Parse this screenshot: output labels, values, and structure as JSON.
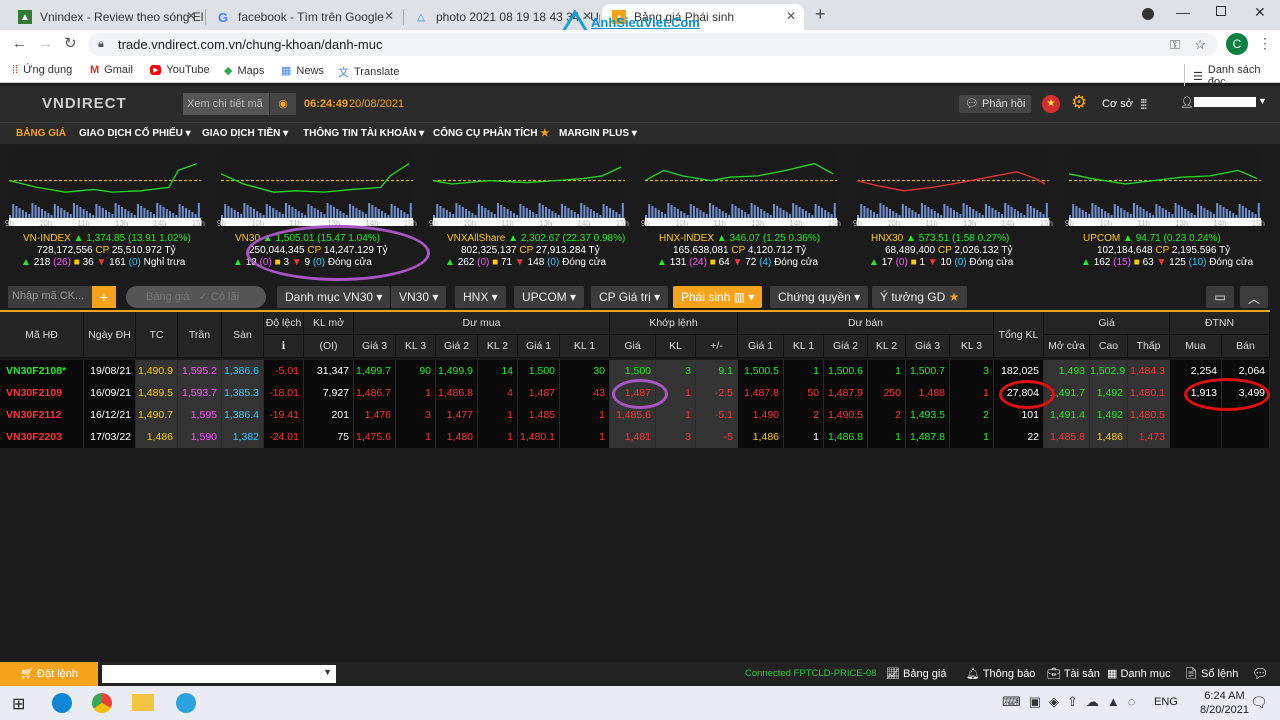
{
  "browser": {
    "tabs": [
      {
        "title": "Vnindex - Review theo sóng Elliott",
        "icon": "chart-favicon"
      },
      {
        "title": "facebook - Tìm trên Google",
        "icon": "google-favicon"
      },
      {
        "title": "photo 2021 08 19 18 43 34 - Up",
        "icon": "upload-favicon"
      },
      {
        "title": "Bảng giá Phái sinh",
        "icon": "vndirect-favicon"
      }
    ],
    "url": "trade.vndirect.com.vn/chung-khoan/danh-muc",
    "profile_letter": "C",
    "bookmarks": [
      "Ứng dụng",
      "Gmail",
      "YouTube",
      "Maps",
      "News",
      "Translate"
    ],
    "reading_list": "Danh sách đọc",
    "watermark": "AnhSieuViet.Com"
  },
  "app": {
    "logo": "VNDIRECT",
    "search_placeholder": "Xem chi tiết mã",
    "clock": "06:24:49",
    "date": "20/08/2021",
    "feedback": "Phản hồi",
    "mode": "Cơ sở",
    "menu": [
      "BẢNG GIÁ",
      "GIAO DỊCH CỔ PHIẾU",
      "GIAO DỊCH TIỀN",
      "THÔNG TIN TÀI KHOẢN",
      "CÔNG CỤ PHÂN TÍCH",
      "MARGIN PLUS"
    ]
  },
  "indices": [
    {
      "name": "VN-INDEX",
      "value": "1,374.85",
      "change": "(13.91 1.02%)",
      "vol": "728,172,556",
      "cp": "CP",
      "val": "25,510.972 Tỷ",
      "up": "218",
      "upc": "(26)",
      "ref": "36",
      "down": "161",
      "downc": "(0)",
      "state": "Nghỉ trưa"
    },
    {
      "name": "VN30",
      "value": "1,505.01",
      "change": "(15.47 1.04%)",
      "vol": "250,044,345",
      "cp": "CP",
      "val": "14,247.129 Tỷ",
      "up": "18",
      "upc": "(0)",
      "ref": "3",
      "down": "9",
      "downc": "(0)",
      "state": "Đóng cửa"
    },
    {
      "name": "VNXAllShare",
      "value": "2,302.67",
      "change": "(22.37 0.98%)",
      "vol": "802,325,137",
      "cp": "CP",
      "val": "27,913.284 Tỷ",
      "up": "262",
      "upc": "(0)",
      "ref": "71",
      "down": "148",
      "downc": "(0)",
      "state": "Đóng cửa"
    },
    {
      "name": "HNX-INDEX",
      "value": "346.07",
      "change": "(1.25 0.36%)",
      "vol": "165,638,081",
      "cp": "CP",
      "val": "4,120.712 Tỷ",
      "up": "131",
      "upc": "(24)",
      "ref": "64",
      "down": "72",
      "downc": "(4)",
      "state": "Đóng cửa"
    },
    {
      "name": "HNX30",
      "value": "573.51",
      "change": "(1.58 0.27%)",
      "vol": "68,489,400",
      "cp": "CP",
      "val": "2,026.132 Tỷ",
      "up": "17",
      "upc": "(0)",
      "ref": "1",
      "down": "10",
      "downc": "(0)",
      "state": "Đóng cửa"
    },
    {
      "name": "UPCOM",
      "value": "94.71",
      "change": "(0.23 0.24%)",
      "vol": "102,184,648",
      "cp": "CP",
      "val": "2,195.596 Tỷ",
      "up": "162",
      "upc": "(15)",
      "ref": "63",
      "down": "125",
      "downc": "(10)",
      "state": "Đóng cửa"
    }
  ],
  "mini_ticks": [
    "9h",
    "10h",
    "11h",
    "13h",
    "14h",
    "15h"
  ],
  "filters": {
    "input_placeholder": "Nhập mã CK...",
    "buttons": [
      "Bảng giá",
      "Có lãi"
    ],
    "tabs": [
      "Danh mục VN30",
      "VN30",
      "HNX",
      "UPCOM",
      "CP Giá trị",
      "Phái sinh",
      "Chứng quyền",
      "Ý tưởng GD"
    ]
  },
  "table": {
    "headers": {
      "ma": "Mã HĐ",
      "ngay": "Ngày ĐH",
      "tc": "TC",
      "tran": "Trần",
      "san": "Sàn",
      "dolech": "Độ lệch",
      "klmo": "KL mở",
      "oi": "(OI)",
      "dumua": "Dư mua",
      "khop": "Khớp lệnh",
      "duban": "Dư bán",
      "tongkl": "Tổng KL",
      "gia": "Giá",
      "dtnn": "ĐTNN"
    },
    "subheaders": {
      "buy": [
        "Giá 3",
        "KL 3",
        "Giá 2",
        "KL 2",
        "Giá 1",
        "KL 1"
      ],
      "match": [
        "Giá",
        "KL",
        "+/-"
      ],
      "sell": [
        "Giá 1",
        "KL 1",
        "Giá 2",
        "KL 2",
        "Giá 3",
        "KL 3"
      ],
      "price": [
        "Mở cửa",
        "Cao",
        "Thấp"
      ],
      "foreign": [
        "Mua",
        "Bán"
      ]
    },
    "rows": [
      [
        "VN30F2108*",
        "19/08/21",
        "1,490.9",
        "1,595.2",
        "1,386.6",
        "-5.01",
        "31,347",
        "1,499.7",
        "90",
        "1,499.9",
        "14",
        "1,500",
        "30",
        "1,500",
        "3",
        "9.1",
        "1,500.5",
        "1",
        "1,500.6",
        "1",
        "1,500.7",
        "3",
        "182,025",
        "1,493",
        "1,502.9",
        "1,484.3",
        "2,254",
        "2,064"
      ],
      [
        "VN30F2109",
        "16/09/21",
        "1,489.5",
        "1,593.7",
        "1,385.3",
        "-18.01",
        "7,927",
        "1,486.7",
        "1",
        "1,486.8",
        "4",
        "1,487",
        "43",
        "1,487",
        "1",
        "-2.5",
        "1,487.8",
        "50",
        "1,487.9",
        "250",
        "1,488",
        "1",
        "27,804",
        "1,491.7",
        "1,492",
        "1,480.1",
        "1,913",
        "3,499"
      ],
      [
        "VN30F2112",
        "16/12/21",
        "1,490.7",
        "1,595",
        "1,386.4",
        "-19.41",
        "201",
        "1,476",
        "3",
        "1,477",
        "1",
        "1,485",
        "1",
        "1,485.6",
        "1",
        "-5.1",
        "1,490",
        "2",
        "1,490.5",
        "2",
        "1,493.5",
        "2",
        "101",
        "1,491.4",
        "1,492",
        "1,480.5",
        "",
        ""
      ],
      [
        "VN30F2203",
        "17/03/22",
        "1,486",
        "1,590",
        "1,382",
        "-24.01",
        "75",
        "1,475.6",
        "1",
        "1,480",
        "1",
        "1,480.1",
        "1",
        "1,481",
        "3",
        "-5",
        "1,486",
        "1",
        "1,486.8",
        "1",
        "1,487.8",
        "1",
        "22",
        "1,485.8",
        "1,486",
        "1,473",
        "",
        ""
      ]
    ]
  },
  "bottom": {
    "order": "Đặt lệnh",
    "connection": "Connected FPTCLD-PRICE-08",
    "links": [
      "Bảng giá",
      "Thông báo",
      "Tài sản",
      "Danh mục",
      "Sổ lệnh"
    ]
  },
  "taskbar": {
    "lang": "ENG",
    "time": "6:24 AM",
    "date": "8/20/2021"
  }
}
